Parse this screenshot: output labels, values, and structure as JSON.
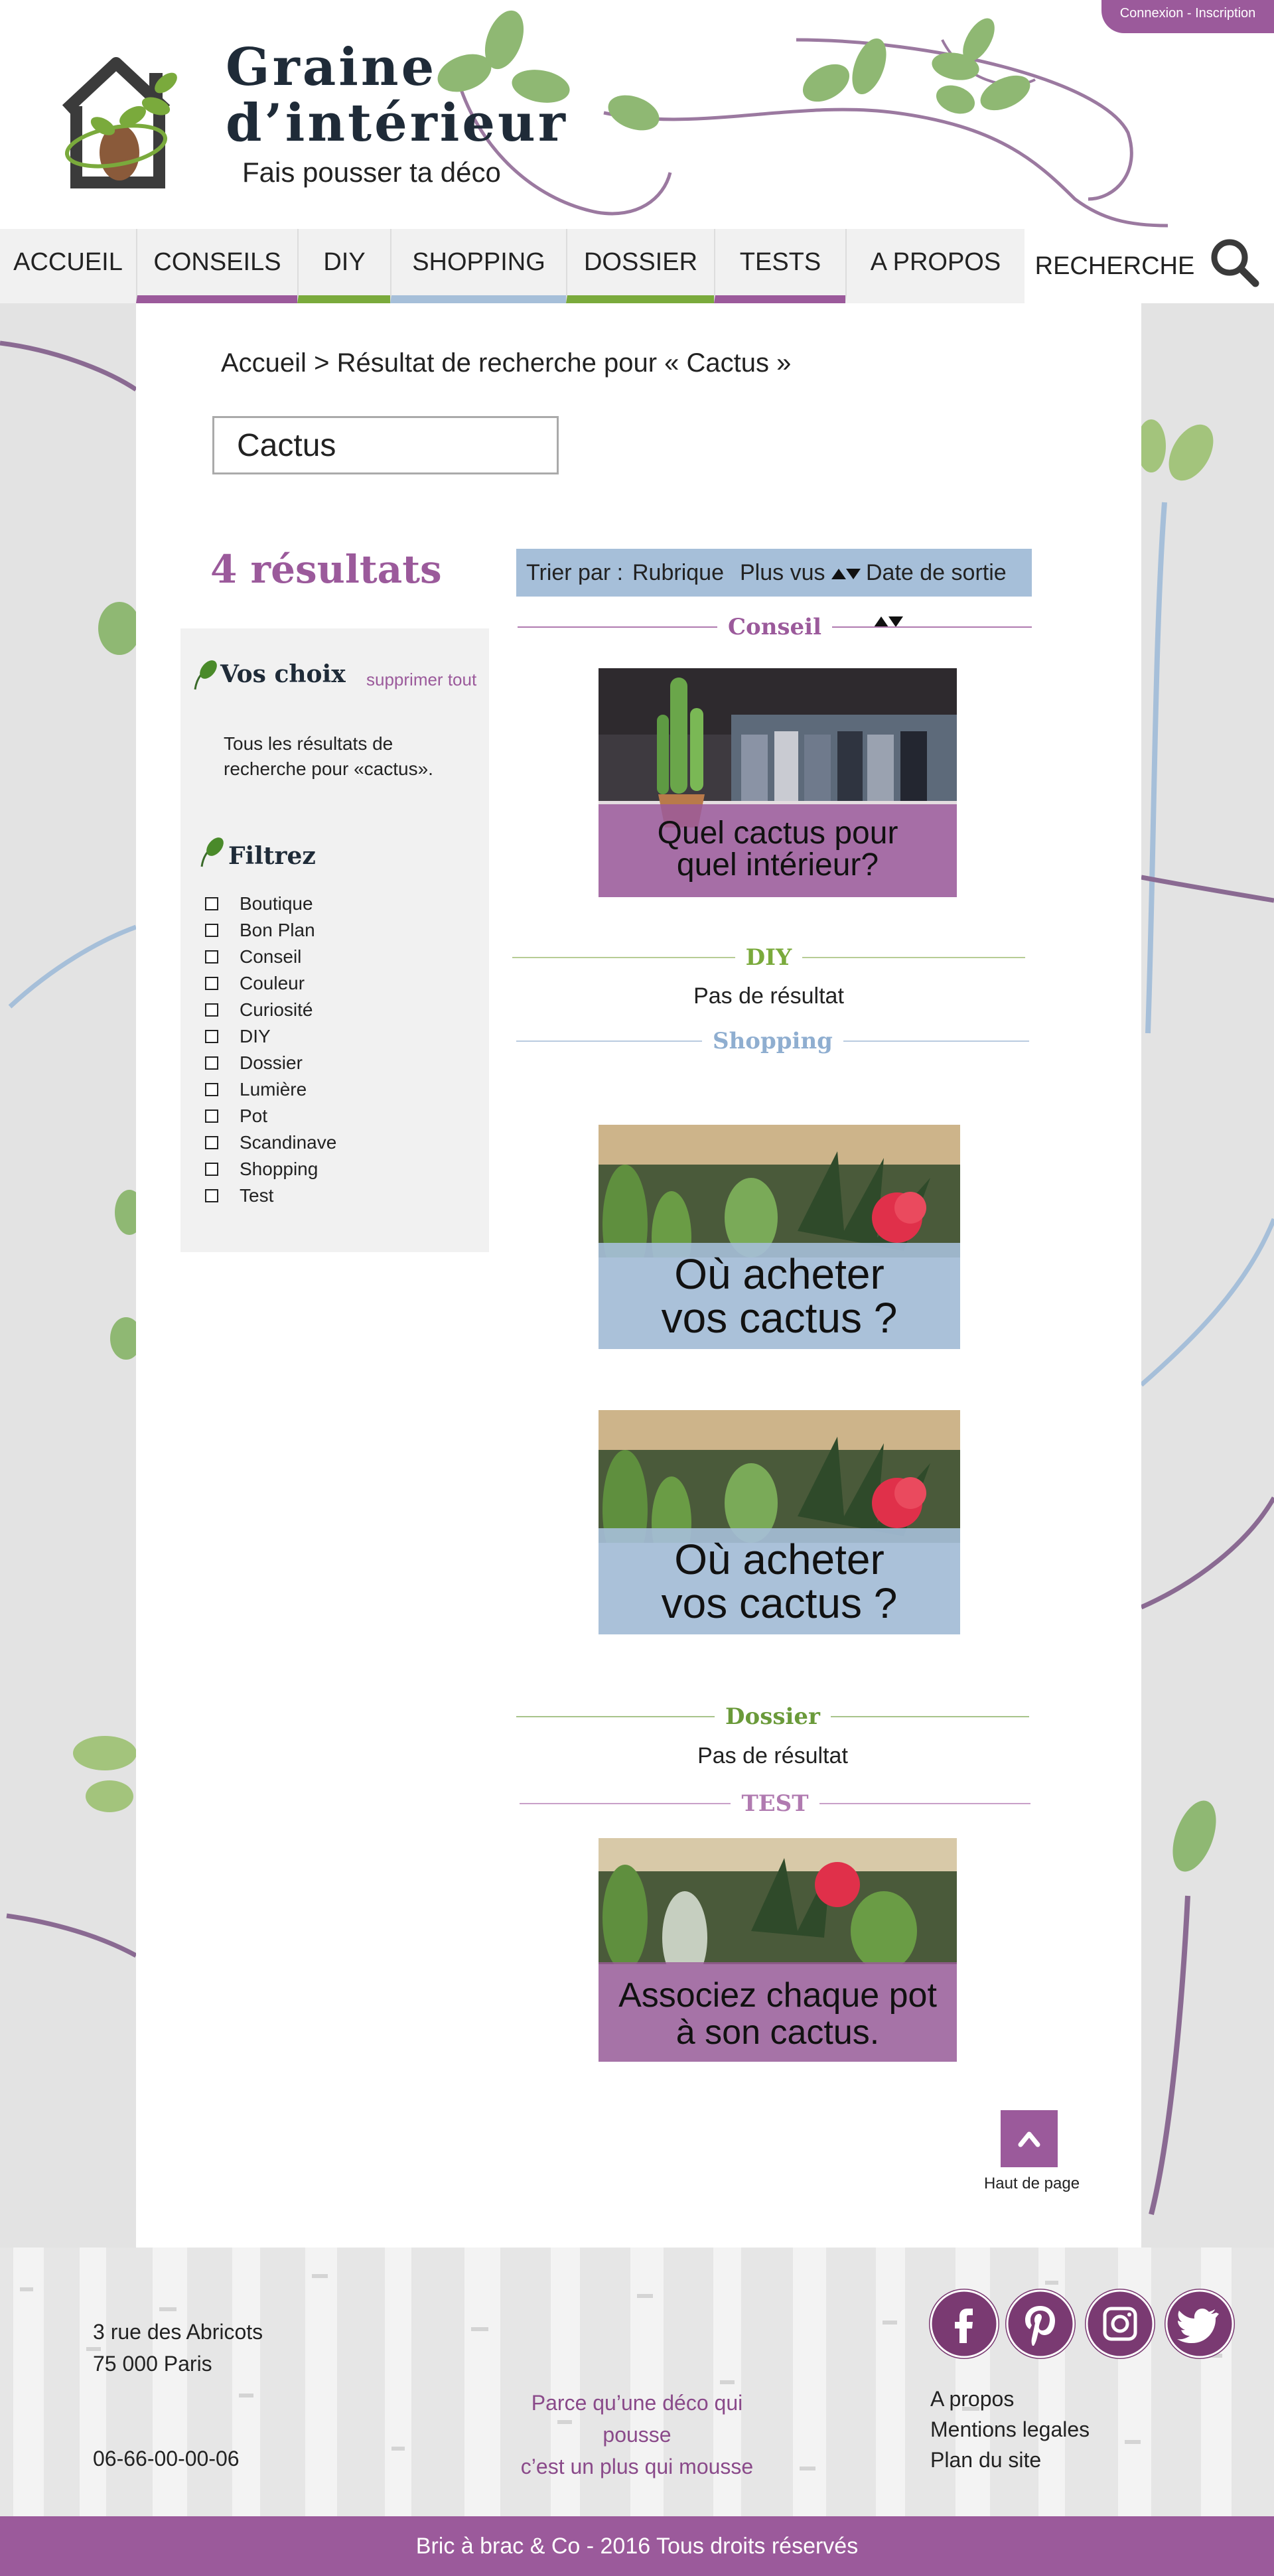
{
  "colors": {
    "accent_purple": "#9b5a9b",
    "accent_green": "#7aaa3c",
    "accent_blue": "#a6bfd9",
    "leaf_green": "#8fb873",
    "dark_text": "#1f2b38"
  },
  "header": {
    "account_link": "Connexion - Inscription",
    "brand_line1": "Graine",
    "brand_line2": "d’intérieur",
    "tagline": "Fais pousser ta déco"
  },
  "nav": {
    "items": [
      {
        "label": "ACCUEIL",
        "underline": "none"
      },
      {
        "label": "CONSEILS",
        "underline": "#9b5a9b"
      },
      {
        "label": "DIY",
        "underline": "#7aaa3c"
      },
      {
        "label": "SHOPPING",
        "underline": "#a6bfd9"
      },
      {
        "label": "DOSSIER",
        "underline": "#7aaa3c"
      },
      {
        "label": "TESTS",
        "underline": "#9b5a9b"
      },
      {
        "label": "A PROPOS",
        "underline": "none"
      }
    ],
    "search_label": "RECHERCHE",
    "search_icon": "search-icon"
  },
  "breadcrumb": {
    "home": "Accueil",
    "separator": ">",
    "current": "Résultat de recherche pour « Cactus »"
  },
  "search": {
    "value": "Cactus"
  },
  "results": {
    "count_label": "4 résultats"
  },
  "sidebar": {
    "choices_title": "Vos choix",
    "clear_all": "supprimer tout",
    "choices_text": "Tous les résultats de recherche pour «cactus».",
    "filter_title": "Filtrez",
    "filters": [
      "Boutique",
      "Bon Plan",
      "Conseil",
      "Couleur",
      "Curiosité",
      "DIY",
      "Dossier",
      "Lumière",
      "Pot",
      "Scandinave",
      "Shopping",
      "Test"
    ]
  },
  "sort": {
    "label": "Trier par :",
    "options": [
      "Rubrique",
      "Plus vus",
      "Date de sortie"
    ]
  },
  "sections": {
    "conseil": {
      "title": "Conseil",
      "color": "#9b5a9b",
      "card": {
        "line1": "Quel cactus pour",
        "line2": "quel intérieur?"
      }
    },
    "diy": {
      "title": "DIY",
      "color": "#7aaa3c",
      "empty": "Pas de résultat"
    },
    "shopping": {
      "title": "Shopping",
      "color": "#8faed0",
      "cards": [
        {
          "line1": "Où acheter",
          "line2": "vos cactus ?"
        },
        {
          "line1": "Où acheter",
          "line2": "vos cactus ?"
        }
      ]
    },
    "dossier": {
      "title": "Dossier",
      "color": "#6a9a3a",
      "empty": "Pas de résultat"
    },
    "test": {
      "title": "TEST",
      "color": "#b07ab0",
      "card": {
        "line1": "Associez chaque pot",
        "line2": "à son cactus."
      }
    }
  },
  "back_to_top": {
    "icon": "^",
    "label": "Haut de page"
  },
  "footer": {
    "address_line1": "3 rue des Abricots",
    "address_line2": "75 000 Paris",
    "phone": "06-66-00-00-06",
    "tagline_line1": "Parce qu’une déco qui pousse",
    "tagline_line2": "c’est un plus qui mousse",
    "links": [
      "A propos",
      "Mentions legales",
      "Plan du site"
    ],
    "social": [
      "facebook-icon",
      "pinterest-icon",
      "instagram-icon",
      "twitter-icon"
    ],
    "copyright": "Bric à brac & Co - 2016 Tous droits réservés"
  }
}
